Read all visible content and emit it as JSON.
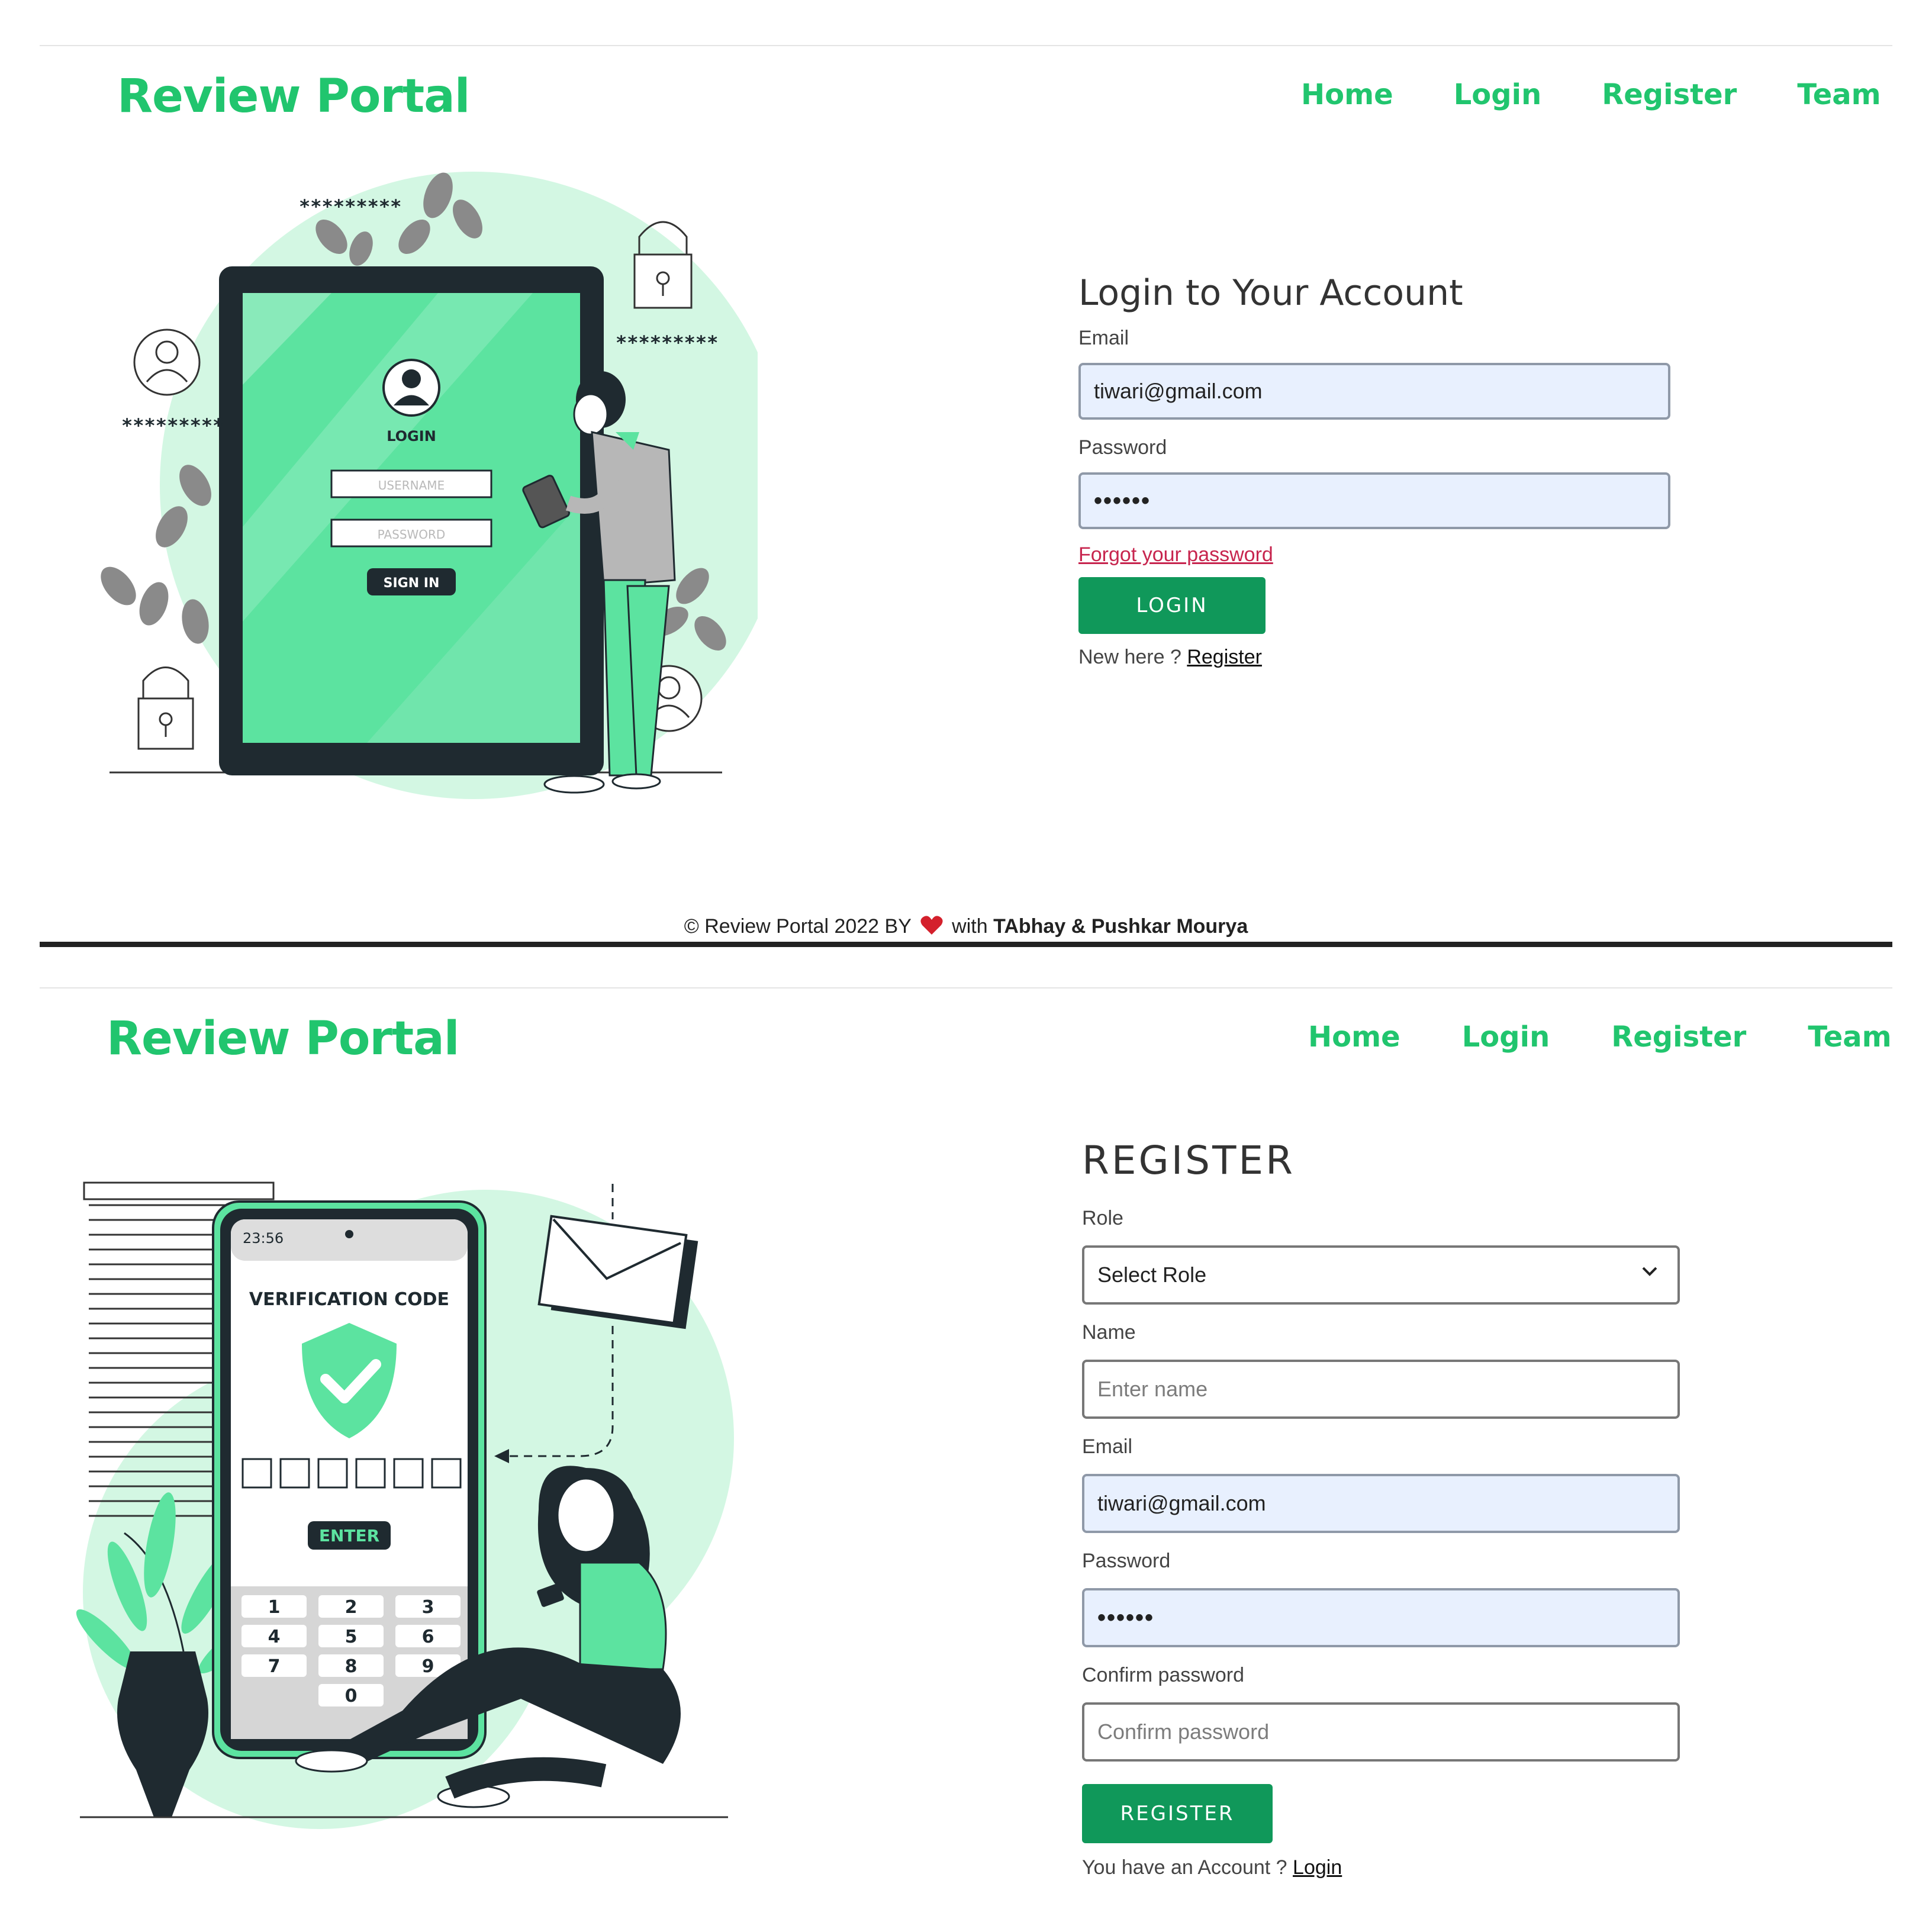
{
  "login_screen": {
    "brand": "Review Portal",
    "nav": [
      "Home",
      "Login",
      "Register",
      "Team"
    ],
    "illustration": {
      "asterisks_1": "*********",
      "asterisks_2": "*********",
      "asterisks_3": "*********",
      "screen_title": "LOGIN",
      "username_placeholder": "USERNAME",
      "password_placeholder": "PASSWORD",
      "signin": "SIGN IN"
    },
    "form": {
      "title": "Login to Your Account",
      "email_label": "Email",
      "email_value": "tiwari@gmail.com",
      "password_label": "Password",
      "password_value": "••••••",
      "forgot": "Forgot your password",
      "login_button": "LOGIN",
      "new_here": "New here ?",
      "register_link": "Register"
    },
    "footer": {
      "prefix": "© Review Portal 2022  BY",
      "with": "with",
      "authors": "TAbhay & Pushkar Mourya"
    }
  },
  "register_screen": {
    "brand": "Review Portal",
    "nav": [
      "Home",
      "Login",
      "Register",
      "Team"
    ],
    "illustration": {
      "time": "23:56",
      "verification_title": "VERIFICATION CODE",
      "enter": "ENTER",
      "keys": [
        "1",
        "2",
        "3",
        "4",
        "5",
        "6",
        "7",
        "8",
        "9",
        "0"
      ]
    },
    "form": {
      "title": "REGISTER",
      "role_label": "Role",
      "role_selected": "Select Role",
      "name_label": "Name",
      "name_placeholder": "Enter name",
      "email_label": "Email",
      "email_value": "tiwari@gmail.com",
      "password_label": "Password",
      "password_value": "••••••",
      "confirm_label": "Confirm password",
      "confirm_placeholder": "Confirm password",
      "register_button": "REGISTER",
      "have_account": "You have an Account ?",
      "login_link": "Login"
    }
  },
  "colors": {
    "brand_green": "#21c56e",
    "button_green": "#10985a",
    "illustration_green": "#5ce3a0",
    "illustration_mint": "#d3f7e3",
    "dark": "#1f2a30",
    "autofill_blue": "#e8f0fe",
    "forgot_red": "#c7254e"
  }
}
